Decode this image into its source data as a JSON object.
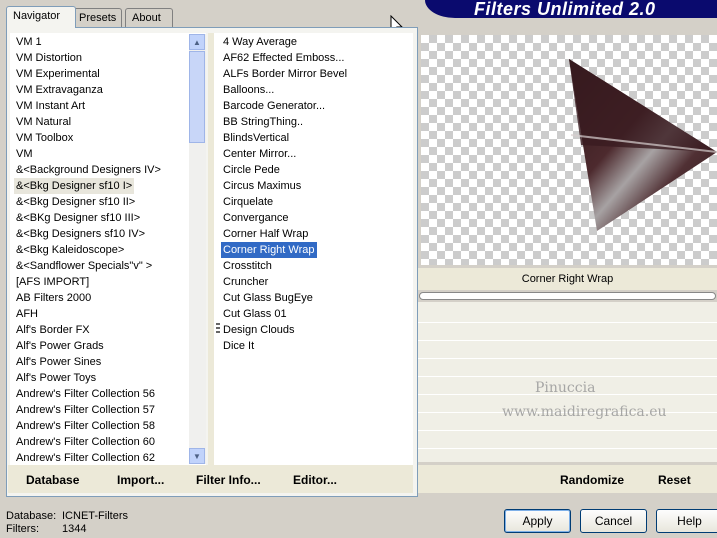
{
  "tabs": [
    "Navigator",
    "Presets",
    "About"
  ],
  "header": {
    "title": "Filters Unlimited 2.0"
  },
  "categories": [
    "VM 1",
    "VM Distortion",
    "VM Experimental",
    "VM Extravaganza",
    "VM Instant Art",
    "VM Natural",
    "VM Toolbox",
    "VM",
    "&<Background Designers IV>",
    "&<Bkg Designer sf10 I>",
    "&<Bkg Designer sf10 II>",
    "&<BKg Designer sf10 III>",
    "&<Bkg Designers sf10 IV>",
    "&<Bkg Kaleidoscope>",
    "&<Sandflower Specials\"v\" >",
    "[AFS IMPORT]",
    "AB Filters 2000",
    "AFH",
    "Alf's Border FX",
    "Alf's Power Grads",
    "Alf's Power Sines",
    "Alf's Power Toys",
    "Andrew's Filter Collection 56",
    "Andrew's Filter Collection 57",
    "Andrew's Filter Collection 58",
    "Andrew's Filter Collection 60",
    "Andrew's Filter Collection 62"
  ],
  "selected_category": "&<Bkg Designer sf10 I>",
  "filters": [
    "4 Way Average",
    "AF62 Effected Emboss...",
    "ALFs Border Mirror Bevel",
    "Balloons...",
    "Barcode Generator...",
    "BB StringThing..",
    "BlindsVertical",
    "Center Mirror...",
    "Circle Pede",
    "Circus Maximus",
    "Cirquelate",
    "Convergance",
    "Corner Half Wrap",
    "Corner Right Wrap",
    "Crosstitch",
    "Cruncher",
    "Cut Glass  BugEye",
    "Cut Glass 01",
    "Design Clouds",
    "Dice It"
  ],
  "selected_filter": "Corner Right Wrap",
  "preview": {
    "filter_name": "Corner Right Wrap",
    "watermark_line1": "Pinuccia",
    "watermark_line2": "www.maidiregrafica.eu"
  },
  "toolbar": {
    "database": "Database",
    "import": "Import...",
    "filter_info": "Filter Info...",
    "editor": "Editor...",
    "randomize": "Randomize",
    "reset": "Reset"
  },
  "status": {
    "database_label": "Database:",
    "database_value": "ICNET-Filters",
    "filters_label": "Filters:",
    "filters_value": "1344"
  },
  "buttons": {
    "apply": "Apply",
    "cancel": "Cancel",
    "help": "Help"
  }
}
